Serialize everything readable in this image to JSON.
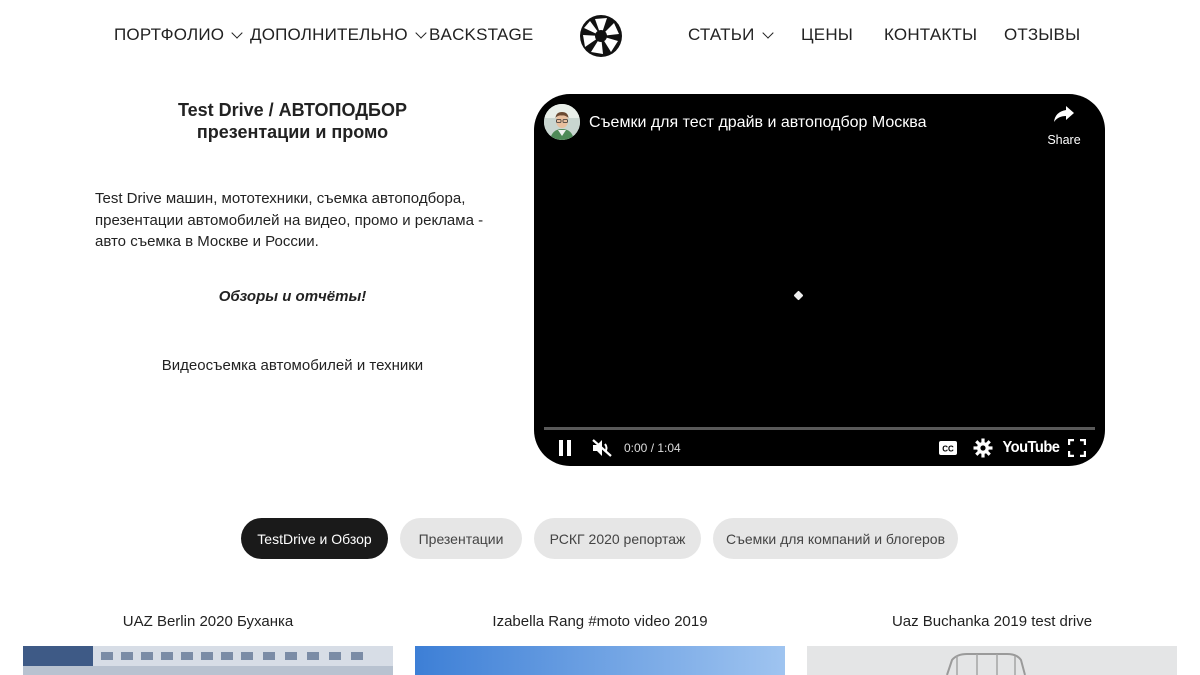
{
  "nav": {
    "left": [
      {
        "label": "ПОРТФОЛИО",
        "dropdown": true
      },
      {
        "label": "ДОПОЛНИТЕЛЬНО",
        "dropdown": true
      },
      {
        "label": "BACKSTAGE",
        "dropdown": false
      }
    ],
    "right": [
      {
        "label": "СТАТЬИ",
        "dropdown": true
      },
      {
        "label": "ЦЕНЫ",
        "dropdown": false
      },
      {
        "label": "КОНТАКТЫ",
        "dropdown": false
      },
      {
        "label": "ОТЗЫВЫ",
        "dropdown": false
      }
    ],
    "logo_icon": "camera-aperture-icon"
  },
  "intro": {
    "title_line1": "Test Drive / АВТОПОДБОР",
    "title_line2": "презентации и промо",
    "description": "Test Drive машин, мототехники, съемка автоподбора, презентации автомобилей на видео, промо и реклама - авто съемка в Москве и России.",
    "highlight": "Обзоры и отчёты!",
    "subtitle": "Видеосъемка автомобилей и техники"
  },
  "video": {
    "title": "Съемки для тест драйв и автоподбор Москва",
    "share_label": "Share",
    "time": "0:00 / 1:04",
    "progress": 0,
    "brand": "YouTube",
    "icons": [
      "pause-icon",
      "muted-icon",
      "captions-icon",
      "settings-icon",
      "fullscreen-icon",
      "share-icon"
    ]
  },
  "filters": [
    {
      "label": "TestDrive и Обзор",
      "active": true
    },
    {
      "label": "Презентации",
      "active": false
    },
    {
      "label": "РСКГ 2020 репортаж",
      "active": false
    },
    {
      "label": "Съемки для компаний и блогеров",
      "active": false
    }
  ],
  "cards": [
    {
      "title": "UAZ Berlin 2020 Буханка"
    },
    {
      "title": "Izabella Rang #moto video 2019"
    },
    {
      "title": "Uaz Buchanka 2019 test drive"
    }
  ],
  "colors": {
    "text": "#222222",
    "pill_active": "#1a1a1a",
    "pill_inactive": "#e6e6e6",
    "video_bg": "#000000"
  }
}
